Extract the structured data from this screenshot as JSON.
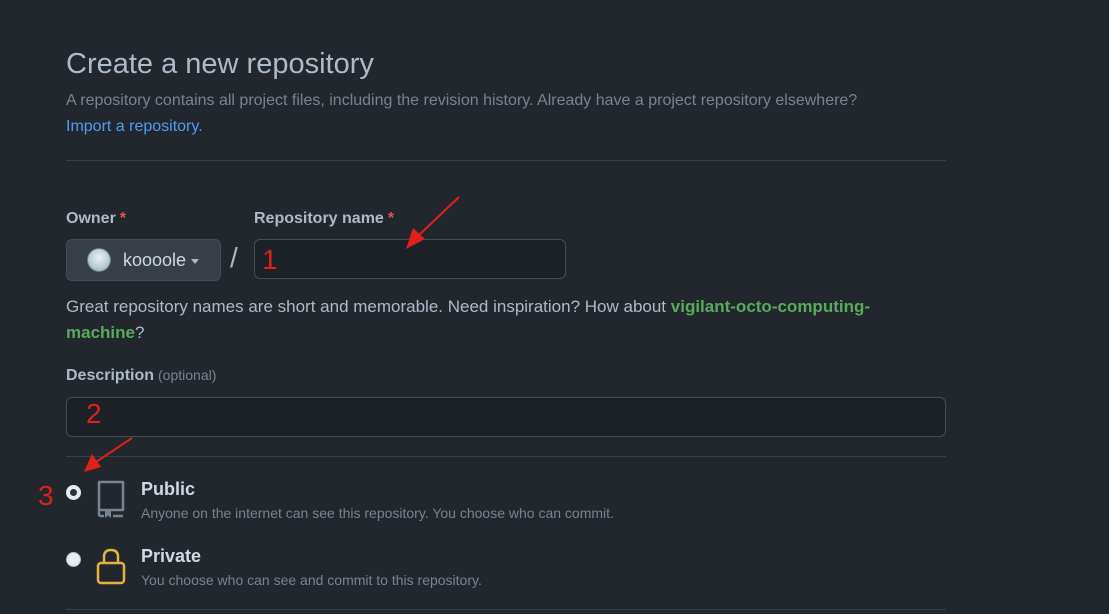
{
  "page": {
    "title": "Create a new repository",
    "subtitle": "A repository contains all project files, including the revision history. Already have a project repository elsewhere?",
    "import_link": "Import a repository."
  },
  "owner": {
    "label": "Owner",
    "required_mark": "*",
    "name": "koooole",
    "avatar_icon": "user-avatar"
  },
  "separator": "/",
  "repo_name": {
    "label": "Repository name",
    "required_mark": "*",
    "value": ""
  },
  "hint": {
    "text": "Great repository names are short and memorable. Need inspiration? How about ",
    "suggestion": "vigilant-octo-computing-machine",
    "end": "?"
  },
  "description": {
    "label": "Description",
    "optional": "(optional)",
    "value": ""
  },
  "visibility": {
    "options": [
      {
        "title": "Public",
        "desc": "Anyone on the internet can see this repository. You choose who can commit.",
        "icon": "repo-icon",
        "checked": true
      },
      {
        "title": "Private",
        "desc": "You choose who can see and commit to this repository.",
        "icon": "lock-icon",
        "checked": false
      }
    ]
  },
  "annotations": {
    "n1": "1",
    "n2": "2",
    "n3": "3"
  },
  "colors": {
    "background": "#22272e",
    "link": "#539bf5",
    "suggestion": "#57ab5a",
    "required": "#e5534b",
    "annotation": "#e0201b",
    "lock": "#e2b340"
  }
}
